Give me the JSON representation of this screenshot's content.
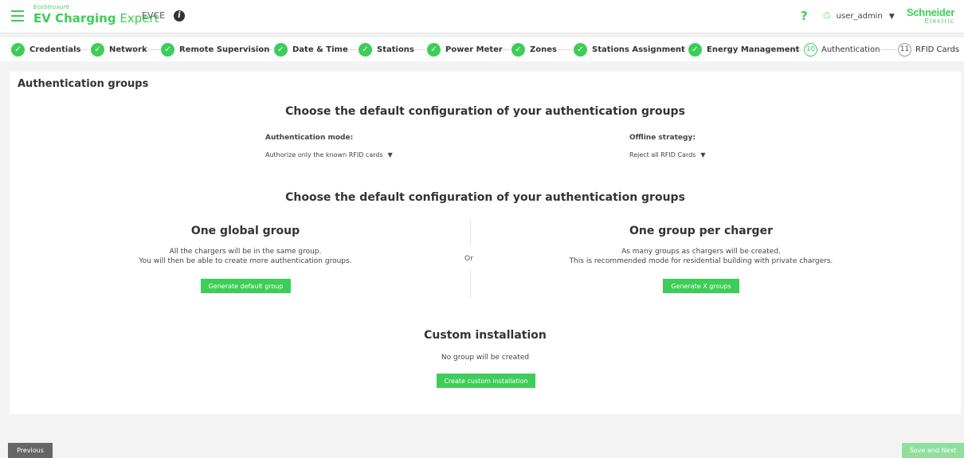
{
  "header": {
    "brand_eco": "EcoStruxure",
    "brand_bold": "EV Charging",
    "brand_light": "Expert",
    "app_code": "EVCE",
    "info_icon": "i",
    "help_icon": "?",
    "user_icon": "♲",
    "user_name": "user_admin",
    "user_caret": "▼",
    "logo_main": "Schneider",
    "logo_sub": "Electric"
  },
  "stepper": {
    "check_glyph": "✓",
    "steps": [
      {
        "label": "Credentials",
        "done": true
      },
      {
        "label": "Network",
        "done": true
      },
      {
        "label": "Remote Supervision",
        "done": true
      },
      {
        "label": "Date & Time",
        "done": true
      },
      {
        "label": "Stations",
        "done": true
      },
      {
        "label": "Power Meter",
        "done": true
      },
      {
        "label": "Zones",
        "done": true
      },
      {
        "label": "Stations Assignment",
        "done": true
      },
      {
        "label": "Energy Management",
        "done": true
      },
      {
        "label": "Authentication",
        "number": "10",
        "current": true
      },
      {
        "label": "RFID Cards",
        "number": "11"
      }
    ]
  },
  "main": {
    "title": "Authentication groups",
    "defaults_title": "Choose the default configuration of your authentication groups",
    "auth_mode_label": "Authentication mode:",
    "auth_mode_value": "Authorize only the known RFID cards",
    "offline_label": "Offline strategy:",
    "offline_value": "Reject all RFID Cards",
    "dropdown_caret": "▼",
    "groups_title": "Choose the default configuration of your authentication groups",
    "global_group": {
      "title": "One global group",
      "line1": "All the chargers will be in the same group.",
      "line2": "You will then be able to create more authentication groups.",
      "button": "Generate default group"
    },
    "or_label": "Or",
    "per_charger": {
      "title": "One group per charger",
      "line1": "As many groups as chargers will be created.",
      "line2": "This is recommended mode for residential building with private chargers.",
      "button": "Generate X groups"
    },
    "custom": {
      "title": "Custom installation",
      "desc": "No group will be created",
      "button": "Create custom installation"
    }
  },
  "footer": {
    "previous": "Previous",
    "save_next": "Save and Next"
  },
  "colors": {
    "accent": "#3dcd58",
    "disabled_accent": "#8fe09e",
    "secondary_button": "#666666"
  }
}
